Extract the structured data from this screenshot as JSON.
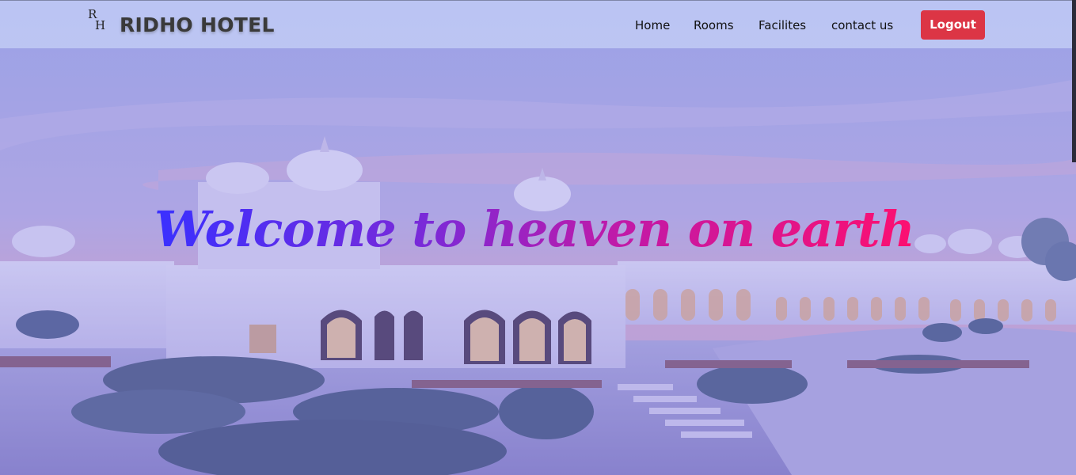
{
  "brand": {
    "logo_mark_r": "R",
    "logo_mark_h": "H",
    "name": "RIDHO HOTEL"
  },
  "nav": {
    "items": [
      {
        "label": "Home"
      },
      {
        "label": "Rooms"
      },
      {
        "label": "Facilites"
      },
      {
        "label": "contact us"
      }
    ],
    "logout_label": "Logout"
  },
  "hero": {
    "headline": "Welcome to heaven on earth"
  },
  "colors": {
    "logout_bg": "#dc3545",
    "headline_start": "#3a30ff",
    "headline_end": "#ff0f6e"
  }
}
